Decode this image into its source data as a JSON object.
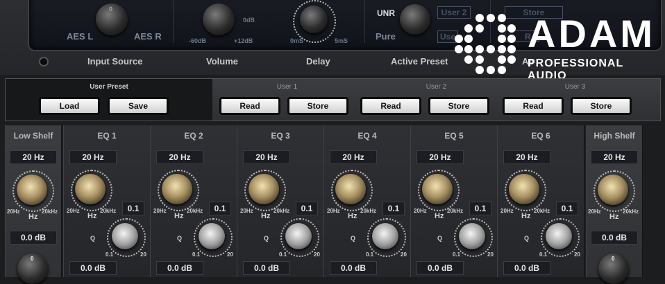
{
  "top_panel": {
    "labels": {
      "input_source": "Input Source",
      "volume": "Volume",
      "delay": "Delay",
      "active_preset": "Active Preset",
      "ap_partial": "Ap"
    },
    "input_source": {
      "top": "0",
      "left": "AES L",
      "right": "AES R"
    },
    "volume": {
      "top": "0dB",
      "left": "-60dB",
      "right": "+12dB"
    },
    "delay": {
      "left": "0mS",
      "right": "5mS"
    },
    "active_preset": {
      "unr": "UNR",
      "pure": "Pure",
      "user2": "User 2",
      "user_partial": "Use"
    },
    "screen_buttons": {
      "store": "Store",
      "r_partial": "R"
    }
  },
  "logo": {
    "brand": "ADAM",
    "tagline": "PROFESSIONAL AUDIO",
    "color": "#ffffff"
  },
  "preset_bar": {
    "user_preset_title": "User Preset",
    "load": "Load",
    "save": "Save",
    "slots": [
      {
        "title": "User 1",
        "read": "Read",
        "store": "Store"
      },
      {
        "title": "User 2",
        "read": "Read",
        "store": "Store"
      },
      {
        "title": "User 3",
        "read": "Read",
        "store": "Store"
      }
    ]
  },
  "eq": {
    "low_shelf": {
      "title": "Low Shelf",
      "freq": "20 Hz",
      "gain": "0.0 dB",
      "min": "20Hz",
      "max": "20kHz",
      "unit": "Hz",
      "top_mark": "0"
    },
    "bands": [
      {
        "title": "EQ 1",
        "freq": "20 Hz",
        "q": "0.1",
        "gain": "0.0 dB"
      },
      {
        "title": "EQ 2",
        "freq": "20 Hz",
        "q": "0.1",
        "gain": "0.0 dB"
      },
      {
        "title": "EQ 3",
        "freq": "20 Hz",
        "q": "0.1",
        "gain": "0.0 dB"
      },
      {
        "title": "EQ 4",
        "freq": "20 Hz",
        "q": "0.1",
        "gain": "0.0 dB"
      },
      {
        "title": "EQ 5",
        "freq": "20 Hz",
        "q": "0.1",
        "gain": "0.0 dB"
      },
      {
        "title": "EQ 6",
        "freq": "20 Hz",
        "q": "0.1",
        "gain": "0.0 dB"
      }
    ],
    "band_labels": {
      "min": "20Hz",
      "max": "20kHz",
      "unit": "Hz",
      "q": "Q",
      "q_min": "0.1",
      "q_max": "20"
    },
    "high_shelf": {
      "title": "High Shelf",
      "freq": "20 Hz",
      "gain": "0.0 dB",
      "min": "20Hz",
      "max": "20kHz",
      "unit": "Hz",
      "top_mark": "0"
    }
  }
}
